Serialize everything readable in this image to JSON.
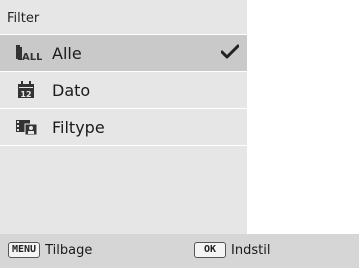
{
  "menu": {
    "title": "Filter",
    "items": [
      {
        "label": "Alle",
        "icon": "all-icon",
        "selected": true
      },
      {
        "label": "Dato",
        "icon": "calendar-date-icon",
        "selected": false
      },
      {
        "label": "Filtype",
        "icon": "filetype-icon",
        "selected": false
      }
    ],
    "all_icon_text": "ALL",
    "date_icon_text": "12"
  },
  "footer": {
    "back_key": "MENU",
    "back_label": "Tilbage",
    "set_key": "OK",
    "set_label": "Indstil"
  },
  "colors": {
    "panel_bg": "#e6e6e6",
    "selected_bg": "#c9c9c9",
    "bottom_bar": "#d6d6d6"
  }
}
